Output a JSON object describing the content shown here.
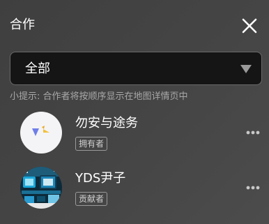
{
  "header": {
    "title": "合作",
    "close_icon": "close-icon"
  },
  "filter": {
    "selected": "全部",
    "arrow_icon": "caret-down-icon"
  },
  "hint": "小提示: 合作者将按顺序显示在地图详情页中",
  "members": [
    {
      "name": "勿安与途务",
      "role": "拥有者",
      "avatar": "blue-yellow-logo-avatar",
      "more_icon": "more-horizontal-icon"
    },
    {
      "name": "YDS尹子",
      "role": "贡献者",
      "avatar": "circuit-board-photo-avatar",
      "more_icon": "more-horizontal-icon"
    }
  ],
  "colors": {
    "background": "#444444",
    "select_background": "#151515",
    "hint_text": "#a8a8a8",
    "tag_border": "#9a9a9a",
    "logo_blue": "#6f7ee8",
    "logo_yellow": "#f2c03a"
  }
}
